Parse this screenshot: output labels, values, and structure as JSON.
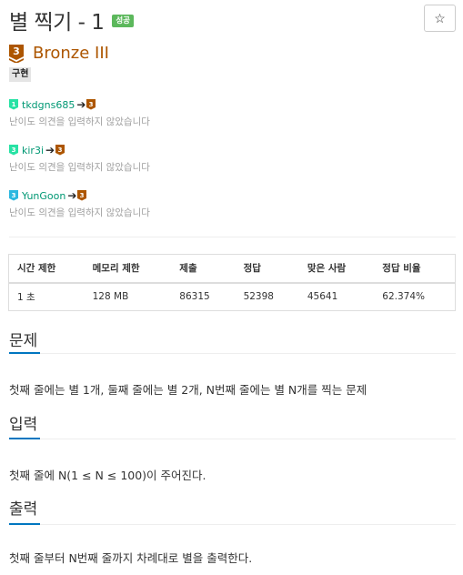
{
  "problem": {
    "title": "별 찍기 - 1",
    "result_badge": "성공",
    "star_icon": "☆",
    "tier_label": "Bronze III",
    "tier_number": "3",
    "tier_color": "#ad5600",
    "tag": "구현"
  },
  "opinions": [
    {
      "user": "tkdgns685",
      "from_tier": "1",
      "from_color": "#27e2a4",
      "arrow": "➔",
      "to_tier": "3",
      "to_color": "#ad5600",
      "note": "난이도 의견을 입력하지 않았습니다"
    },
    {
      "user": "kir3i",
      "from_tier": "3",
      "from_color": "#27e2a4",
      "arrow": "➔",
      "to_tier": "3",
      "to_color": "#ad5600",
      "note": "난이도 의견을 입력하지 않았습니다"
    },
    {
      "user": "YunGoon",
      "from_tier": "3",
      "from_color": "#2db8e0",
      "arrow": "➔",
      "to_tier": "3",
      "to_color": "#ad5600",
      "note": "난이도 의견을 입력하지 않았습니다"
    }
  ],
  "stats": {
    "headers": [
      "시간 제한",
      "메모리 제한",
      "제출",
      "정답",
      "맞은 사람",
      "정답 비율"
    ],
    "values": [
      "1 초",
      "128 MB",
      "86315",
      "52398",
      "45641",
      "62.374%"
    ]
  },
  "sections": [
    {
      "title": "문제",
      "body": "첫째 줄에는 별 1개, 둘째 줄에는 별 2개, N번째 줄에는 별 N개를 찍는 문제"
    },
    {
      "title": "입력",
      "body": "첫째 줄에 N(1 ≤ N ≤ 100)이 주어진다."
    },
    {
      "title": "출력",
      "body": "첫째 줄부터 N번째 줄까지 차례대로 별을 출력한다."
    }
  ],
  "accent_color": "#0076c0"
}
